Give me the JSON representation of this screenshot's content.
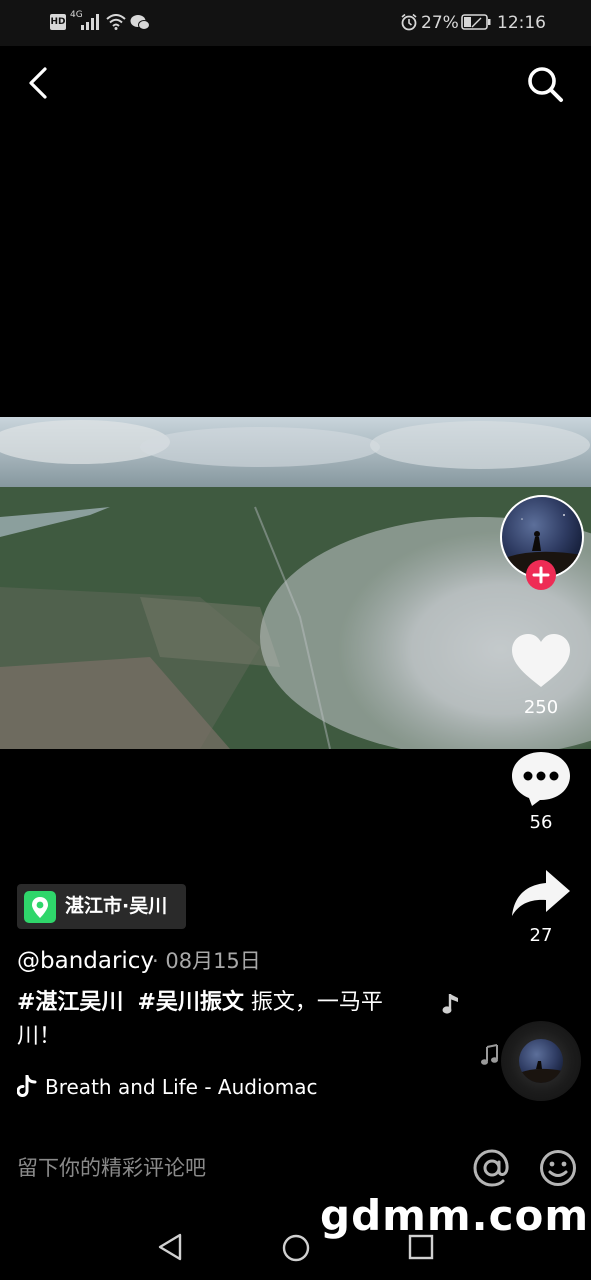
{
  "status_bar": {
    "network_labels": [
      "HD",
      "4G"
    ],
    "battery_percent": "27%",
    "time": "12:16"
  },
  "header": {
    "back_icon": "chevron-left-icon",
    "search_icon": "search-icon"
  },
  "actions": {
    "likes": "250",
    "comments": "56",
    "shares": "27"
  },
  "post": {
    "location": "湛江市·吴川",
    "author": "@bandaricy",
    "date": "· 08月15日",
    "hashtag_1": "#湛江吴川",
    "hashtag_2": "#吴川振文",
    "caption_rest": "振文，一马平",
    "caption_line2": "川！",
    "music": "Breath and Life - Audiomac"
  },
  "comment_bar": {
    "placeholder": "留下你的精彩评论吧"
  },
  "watermark": "gdmm.com",
  "colors": {
    "follow_badge": "#ee2c55",
    "location_pin": "#2fd66b",
    "chip_bg": "#2a2a2a"
  }
}
